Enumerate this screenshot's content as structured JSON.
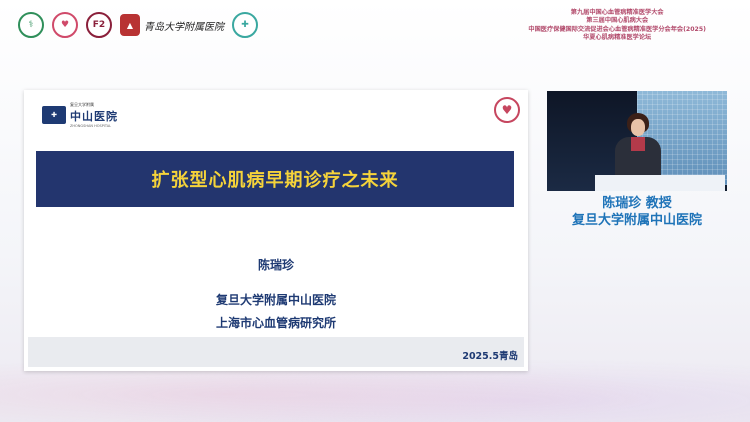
{
  "header": {
    "logo_text": "青岛大学附属医院",
    "conference_lines": [
      "第九届中国心血管病精准医学大会",
      "第三届中国心肌病大会",
      "中国医疗保健国际交流促进会心血管病精准医学分会年会(2025)",
      "华夏心肌病精准医学论坛"
    ]
  },
  "slide": {
    "hospital_small": "复旦大学附属",
    "hospital_name": "中山医院",
    "hospital_en": "ZHONGSHAN HOSPITAL",
    "title": "扩张型心肌病早期诊疗之未来",
    "speaker": "陈瑞珍",
    "affiliation1": "复旦大学附属中山医院",
    "affiliation2": "上海市心血管病研究所",
    "footer_date": "2025.5青岛"
  },
  "speaker_panel": {
    "name_title": "陈瑞珍  教授",
    "organization": "复旦大学附属中山医院"
  }
}
